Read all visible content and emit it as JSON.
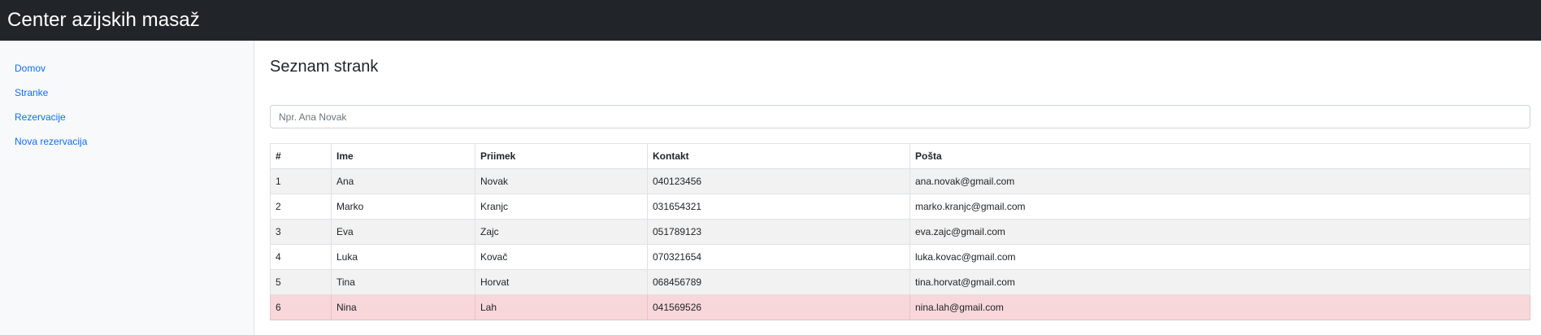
{
  "app": {
    "title": "Center azijskih masaž"
  },
  "sidebar": {
    "items": [
      {
        "label": "Domov"
      },
      {
        "label": "Stranke"
      },
      {
        "label": "Rezervacije"
      },
      {
        "label": "Nova rezervacija"
      }
    ]
  },
  "main": {
    "title": "Seznam strank",
    "search": {
      "placeholder": "Npr. Ana Novak",
      "value": ""
    },
    "table": {
      "headers": [
        "#",
        "Ime",
        "Priimek",
        "Kontakt",
        "Pošta"
      ],
      "rows": [
        [
          "1",
          "Ana",
          "Novak",
          "040123456",
          "ana.novak@gmail.com"
        ],
        [
          "2",
          "Marko",
          "Kranjc",
          "031654321",
          "marko.kranjc@gmail.com"
        ],
        [
          "3",
          "Eva",
          "Zajc",
          "051789123",
          "eva.zajc@gmail.com"
        ],
        [
          "4",
          "Luka",
          "Kovač",
          "070321654",
          "luka.kovac@gmail.com"
        ],
        [
          "5",
          "Tina",
          "Horvat",
          "068456789",
          "tina.horvat@gmail.com"
        ],
        [
          "6",
          "Nina",
          "Lah",
          "041569526",
          "nina.lah@gmail.com"
        ]
      ],
      "highlighted_row": 6
    }
  },
  "colors": {
    "topbar": "#212529",
    "link": "#0d6efd",
    "stripe": "#f2f2f2",
    "highlight": "#f8d7da"
  }
}
